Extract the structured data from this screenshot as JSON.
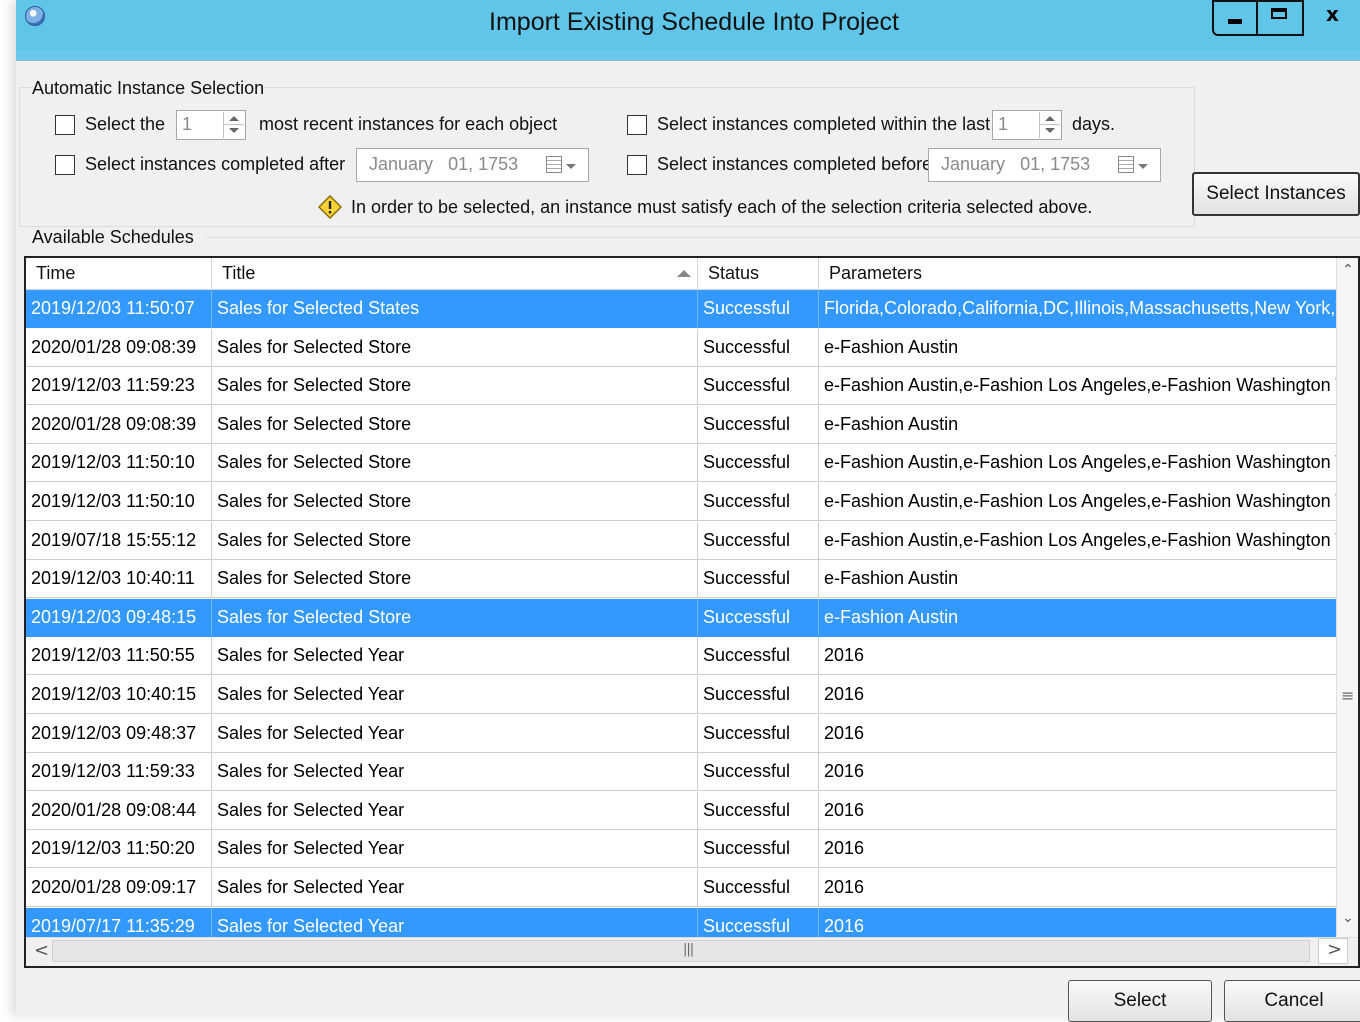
{
  "window": {
    "title": "Import Existing Schedule Into Project",
    "minimize_glyph": "",
    "maximize_glyph": "",
    "close_glyph": "x"
  },
  "auto": {
    "group_label": "Automatic Instance Selection",
    "recent": {
      "prefix": "Select the",
      "value": "1",
      "suffix": "most recent instances for each object"
    },
    "within": {
      "prefix": "Select instances completed within the last",
      "value": "1",
      "suffix": "days."
    },
    "after": {
      "label": "Select instances completed after",
      "month": "January",
      "day_year": "01, 1753"
    },
    "before": {
      "label": "Select instances completed before",
      "month": "January",
      "day_year": "01, 1753"
    },
    "note": "In order to be selected, an instance must satisfy each of the selection criteria selected above.",
    "select_instances_label": "Select Instances"
  },
  "schedules": {
    "label": "Available Schedules",
    "columns": [
      "Time",
      "Title",
      "Status",
      "Parameters"
    ],
    "rows": [
      {
        "time": "2019/12/03 11:50:07",
        "title": "Sales for Selected States",
        "status": "Successful",
        "params": "Florida,Colorado,California,DC,Illinois,Massachusetts,New York,Texas",
        "selected": true
      },
      {
        "time": "2020/01/28 09:08:39",
        "title": "Sales for Selected Store",
        "status": "Successful",
        "params": "e-Fashion Austin",
        "selected": false
      },
      {
        "time": "2019/12/03 11:59:23",
        "title": "Sales for Selected Store",
        "status": "Successful",
        "params": "e-Fashion Austin,e-Fashion Los Angeles,e-Fashion Washington Tolbooth",
        "selected": false
      },
      {
        "time": "2020/01/28 09:08:39",
        "title": "Sales for Selected Store",
        "status": "Successful",
        "params": "e-Fashion Austin",
        "selected": false
      },
      {
        "time": "2019/12/03 11:50:10",
        "title": "Sales for Selected Store",
        "status": "Successful",
        "params": "e-Fashion Austin,e-Fashion Los Angeles,e-Fashion Washington Tolbooth",
        "selected": false
      },
      {
        "time": "2019/12/03 11:50:10",
        "title": "Sales for Selected Store",
        "status": "Successful",
        "params": "e-Fashion Austin,e-Fashion Los Angeles,e-Fashion Washington Tolbooth",
        "selected": false
      },
      {
        "time": "2019/07/18 15:55:12",
        "title": "Sales for Selected Store",
        "status": "Successful",
        "params": "e-Fashion Austin,e-Fashion Los Angeles,e-Fashion Washington Tolbooth",
        "selected": false
      },
      {
        "time": "2019/12/03 10:40:11",
        "title": "Sales for Selected Store",
        "status": "Successful",
        "params": "e-Fashion Austin",
        "selected": false
      },
      {
        "time": "2019/12/03 09:48:15",
        "title": "Sales for Selected Store",
        "status": "Successful",
        "params": "e-Fashion Austin",
        "selected": true
      },
      {
        "time": "2019/12/03 11:50:55",
        "title": "Sales for Selected Year",
        "status": "Successful",
        "params": "2016",
        "selected": false
      },
      {
        "time": "2019/12/03 10:40:15",
        "title": "Sales for Selected Year",
        "status": "Successful",
        "params": "2016",
        "selected": false
      },
      {
        "time": "2019/12/03 09:48:37",
        "title": "Sales for Selected Year",
        "status": "Successful",
        "params": "2016",
        "selected": false
      },
      {
        "time": "2019/12/03 11:59:33",
        "title": "Sales for Selected Year",
        "status": "Successful",
        "params": "2016",
        "selected": false
      },
      {
        "time": "2020/01/28 09:08:44",
        "title": "Sales for Selected Year",
        "status": "Successful",
        "params": "2016",
        "selected": false
      },
      {
        "time": "2019/12/03 11:50:20",
        "title": "Sales for Selected Year",
        "status": "Successful",
        "params": "2016",
        "selected": false
      },
      {
        "time": "2020/01/28 09:09:17",
        "title": "Sales for Selected Year",
        "status": "Successful",
        "params": "2016",
        "selected": false
      },
      {
        "time": "2019/07/17 11:35:29",
        "title": "Sales for Selected Year",
        "status": "Successful",
        "params": "2016",
        "selected": true
      }
    ]
  },
  "footer": {
    "select_label": "Select",
    "cancel_label": "Cancel"
  },
  "colors": {
    "titlebar": "#5fc6e9",
    "selection": "#3399ff"
  }
}
